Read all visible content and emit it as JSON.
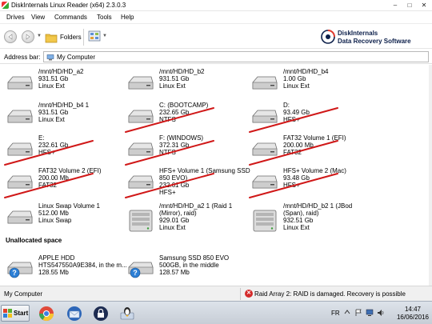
{
  "window": {
    "title": "DiskInternals Linux Reader (x64) 2.3.0.3",
    "controls": [
      "–",
      "□",
      "✕"
    ]
  },
  "menu": [
    "Drives",
    "View",
    "Commands",
    "Tools",
    "Help"
  ],
  "toolbar": {
    "folders_label": "Folders",
    "brand_line1": "DiskInternals",
    "brand_line2": "Data Recovery Software"
  },
  "address": {
    "label": "Address bar:",
    "value": "My Computer"
  },
  "drives": [
    {
      "name": "/mnt/HD/HD_a2",
      "size": "931.51 Gb",
      "fs": "Linux Ext",
      "struck": false,
      "icon": "hdd-icon"
    },
    {
      "name": "/mnt/HD/HD_b2",
      "size": "931.51 Gb",
      "fs": "Linux Ext",
      "struck": false,
      "icon": "hdd-icon"
    },
    {
      "name": "/mnt/HD/HD_b4",
      "size": "1.00 Gb",
      "fs": "Linux Ext",
      "struck": false,
      "icon": "hdd-icon"
    },
    {
      "name": "/mnt/HD/HD_b4 1",
      "size": "931.51 Gb",
      "fs": "Linux Ext",
      "struck": false,
      "icon": "hdd-icon"
    },
    {
      "name": "C: (BOOTCAMP)",
      "size": "232.65 Gb",
      "fs": "NTFS",
      "struck": true,
      "icon": "hdd-icon"
    },
    {
      "name": "D:",
      "size": "93.49 Gb",
      "fs": "HFS+",
      "struck": true,
      "icon": "hdd-icon"
    },
    {
      "name": "E:",
      "size": "232.61 Gb",
      "fs": "HFS+",
      "struck": true,
      "icon": "hdd-icon"
    },
    {
      "name": "F: (WINDOWS)",
      "size": "372.31 Gb",
      "fs": "NTFS",
      "struck": true,
      "icon": "hdd-icon"
    },
    {
      "name": "FAT32 Volume 1 (EFI)",
      "size": "200.00 Mb",
      "fs": "FAT32",
      "struck": true,
      "icon": "hdd-icon"
    },
    {
      "name": "FAT32 Volume 2 (EFI)",
      "size": "200.00 Mb",
      "fs": "FAT32",
      "struck": true,
      "icon": "hdd-icon"
    },
    {
      "name": "HFS+ Volume 1 (Samsung SSD 850 EVO)",
      "size": "232.61 Gb",
      "fs": "HFS+",
      "struck": true,
      "icon": "hdd-icon"
    },
    {
      "name": "HFS+ Volume 2 (Mac)",
      "size": "93.48 Gb",
      "fs": "HFS+",
      "struck": true,
      "icon": "hdd-icon"
    },
    {
      "name": "Linux Swap Volume 1",
      "size": "512.00 Mb",
      "fs": "Linux Swap",
      "struck": false,
      "icon": "hdd-icon"
    },
    {
      "name": "/mnt/HD/HD_a2 1 (Raid 1 (Mirror), raid)",
      "size": "929.01 Gb",
      "fs": "Linux Ext",
      "struck": false,
      "icon": "raid-icon"
    },
    {
      "name": "/mnt/HD/HD_b2 1 (JBod (Span), raid)",
      "size": "932.51 Gb",
      "fs": "Linux Ext",
      "struck": false,
      "icon": "raid-icon"
    }
  ],
  "unallocated": {
    "header": "Unallocated space",
    "items": [
      {
        "name": "APPLE HDD HTS547550A9E384, in the m...",
        "size": "128.55 Mb",
        "icon": "unknown-drive-icon"
      },
      {
        "name": "Samsung SSD 850 EVO 500GB, in the middle",
        "size": "128.57 Mb",
        "icon": "unknown-drive-icon"
      }
    ]
  },
  "status": {
    "left": "My Computer",
    "right": "Raid Array 2: RAID is damaged. Recovery is possible"
  },
  "taskbar": {
    "start_label": "Start",
    "lang": "FR",
    "time": "14:47",
    "date": "16/06/2016"
  },
  "colors": {
    "strike": "#d01818",
    "brand": "#0c1f4a",
    "error": "#d42a2a"
  }
}
